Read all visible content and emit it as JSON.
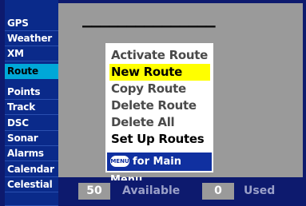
{
  "sidebar": {
    "tabs": [
      {
        "label": "GPS"
      },
      {
        "label": "Weather"
      },
      {
        "label": "XM"
      },
      {
        "label": "Route",
        "active": true
      },
      {
        "label": "Points"
      },
      {
        "label": "Track"
      },
      {
        "label": "DSC"
      },
      {
        "label": "Sonar"
      },
      {
        "label": "Alarms"
      },
      {
        "label": "Calendar"
      },
      {
        "label": "Celestial"
      }
    ]
  },
  "main": {
    "route_name_placeholder": "———————————————"
  },
  "menu": {
    "items": [
      {
        "label": "Activate Route"
      },
      {
        "label": "New Route",
        "selected": true
      },
      {
        "label": "Copy Route"
      },
      {
        "label": "Delete Route"
      },
      {
        "label": "Delete All"
      },
      {
        "label": "Set Up Routes"
      }
    ],
    "footer": {
      "button_label": "MENU",
      "text": "for Main Menu"
    }
  },
  "status": {
    "available_count": "50",
    "available_label": "Available",
    "used_count": "0",
    "used_label": "Used"
  },
  "colors": {
    "background": "#0d1a6e",
    "sidebar": "#0a2a8a",
    "active_tab": "#00a8d8",
    "panel": "#9a9a9a",
    "highlight": "#ffff00",
    "menu_footer": "#1030a0"
  }
}
